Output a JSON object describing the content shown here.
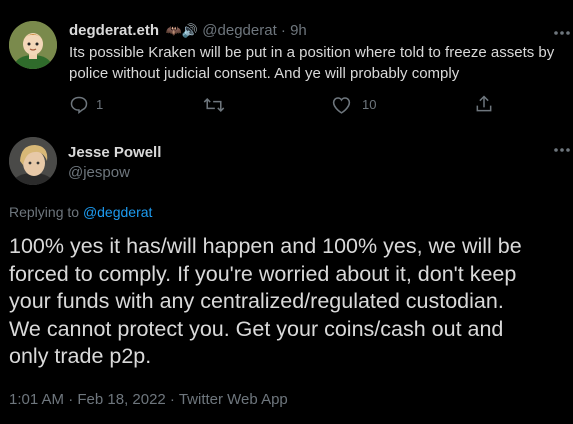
{
  "parent": {
    "display_name": "degderat.eth",
    "name_emojis": "🦇🔊",
    "handle": "@degderat",
    "separator": " · ",
    "time": "9h",
    "text_line1": "Its possible Kraken will be put in a position where told to freeze assets by",
    "text_line2": "police without judicial consent. And ye will probably comply",
    "reply_count": "1",
    "like_count": "10"
  },
  "main": {
    "display_name": "Jesse Powell",
    "handle": "@jespow",
    "replying_prefix": "Replying to ",
    "replying_handle": "@degderat",
    "text_lines": [
      "100% yes it has/will happen and 100% yes, we will be",
      "forced to comply. If you're worried about it, don't keep",
      "your funds with any centralized/regulated custodian.",
      "We cannot protect you. Get your coins/cash out and",
      "only trade p2p."
    ],
    "timestamp": "1:01 AM · Feb 18, 2022 · Twitter Web App"
  },
  "colors": {
    "background": "#000000",
    "text": "#d9d9d9",
    "muted": "#6e767d",
    "link": "#1d9bf0"
  },
  "icons": [
    "reply-icon",
    "retweet-icon",
    "like-icon",
    "share-icon",
    "more-icon"
  ]
}
